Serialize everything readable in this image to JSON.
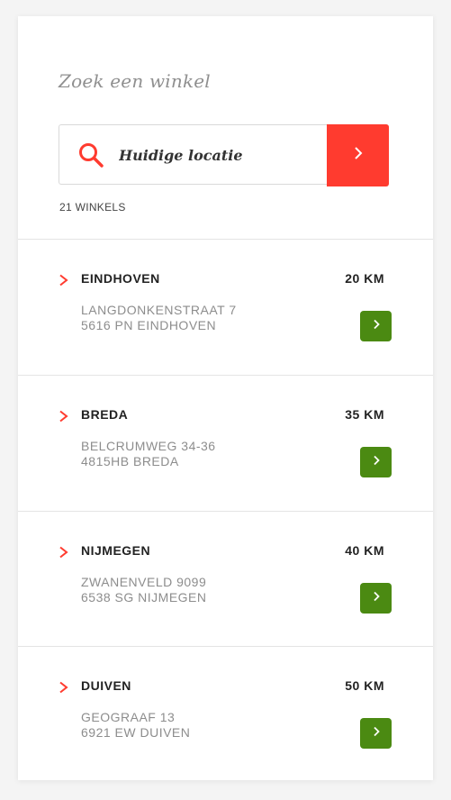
{
  "search": {
    "title": "Zoek een winkel",
    "placeholder": "Huidige locatie",
    "value": "",
    "button_icon": "chevron-right-icon"
  },
  "results": {
    "count_label": "21 WINKELS"
  },
  "stores": [
    {
      "name": "EINDHOVEN",
      "distance": "20 KM",
      "address_line1": "LANGDONKENSTRAAT 7",
      "address_line2": "5616 PN EINDHOVEN"
    },
    {
      "name": "BREDA",
      "distance": "35 KM",
      "address_line1": "BELCRUMWEG 34-36",
      "address_line2": "4815HB BREDA"
    },
    {
      "name": "NIJMEGEN",
      "distance": "40 KM",
      "address_line1": "ZWANENVELD 9099",
      "address_line2": "6538 SG NIJMEGEN"
    },
    {
      "name": "DUIVEN",
      "distance": "50 KM",
      "address_line1": "GEOGRAAF 13",
      "address_line2": "6921 EW DUIVEN"
    }
  ],
  "colors": {
    "accent_red": "#ff3b2f",
    "go_green": "#4b8a12",
    "muted_text": "#8d8d8d"
  }
}
